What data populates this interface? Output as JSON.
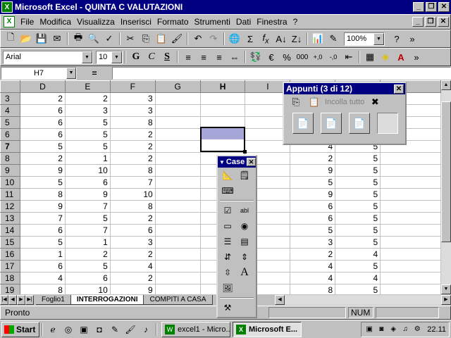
{
  "window": {
    "title": "Microsoft Excel - QUINTA C VALUTAZIONI"
  },
  "menu": [
    "File",
    "Modifica",
    "Visualizza",
    "Inserisci",
    "Formato",
    "Strumenti",
    "Dati",
    "Finestra",
    "?"
  ],
  "toolbar": {
    "zoom": "100%"
  },
  "format": {
    "font": "Arial",
    "size": "10"
  },
  "formula": {
    "cell": "H7",
    "fx": "=",
    "value": ""
  },
  "columns": [
    "D",
    "E",
    "F",
    "G",
    "H",
    "I",
    "J",
    "K"
  ],
  "selected": {
    "column": "H",
    "row": "7"
  },
  "rows": [
    {
      "n": "3",
      "cells": [
        "2",
        "2",
        "3",
        "",
        "",
        "",
        "",
        ""
      ]
    },
    {
      "n": "4",
      "cells": [
        "6",
        "3",
        "3",
        "",
        "",
        "",
        "",
        ""
      ]
    },
    {
      "n": "5",
      "cells": [
        "6",
        "5",
        "8",
        "",
        "",
        "",
        "",
        ""
      ]
    },
    {
      "n": "6",
      "cells": [
        "6",
        "5",
        "2",
        "",
        "",
        "",
        "",
        ""
      ]
    },
    {
      "n": "7",
      "cells": [
        "5",
        "5",
        "2",
        "",
        "",
        "",
        "4",
        "5"
      ]
    },
    {
      "n": "8",
      "cells": [
        "2",
        "1",
        "2",
        "",
        "",
        "",
        "2",
        "5"
      ]
    },
    {
      "n": "9",
      "cells": [
        "9",
        "10",
        "8",
        "",
        "",
        "",
        "9",
        "5"
      ]
    },
    {
      "n": "10",
      "cells": [
        "5",
        "6",
        "7",
        "",
        "",
        "",
        "5",
        "5"
      ]
    },
    {
      "n": "11",
      "cells": [
        "8",
        "9",
        "10",
        "",
        "",
        "",
        "9",
        "5"
      ]
    },
    {
      "n": "12",
      "cells": [
        "9",
        "7",
        "8",
        "",
        "",
        "",
        "6",
        "5"
      ]
    },
    {
      "n": "13",
      "cells": [
        "7",
        "5",
        "2",
        "",
        "",
        "",
        "6",
        "5"
      ]
    },
    {
      "n": "14",
      "cells": [
        "6",
        "7",
        "6",
        "",
        "",
        "",
        "5",
        "5"
      ]
    },
    {
      "n": "15",
      "cells": [
        "5",
        "1",
        "3",
        "",
        "",
        "",
        "3",
        "5"
      ]
    },
    {
      "n": "16",
      "cells": [
        "1",
        "2",
        "2",
        "",
        "",
        "",
        "2",
        "4"
      ]
    },
    {
      "n": "17",
      "cells": [
        "6",
        "5",
        "4",
        "",
        "",
        "",
        "4",
        "5"
      ]
    },
    {
      "n": "18",
      "cells": [
        "4",
        "6",
        "2",
        "",
        "",
        "",
        "4",
        "4"
      ]
    },
    {
      "n": "19",
      "cells": [
        "8",
        "10",
        "9",
        "",
        "",
        "",
        "8",
        "5"
      ]
    }
  ],
  "sheets": [
    "Foglio1",
    "INTERROGAZIONI",
    "COMPITI A CASA"
  ],
  "active_sheet": "INTERROGAZIONI",
  "status": {
    "text": "Pronto",
    "num": "NUM"
  },
  "clipboard": {
    "title": "Appunti (3 di 12)",
    "paste_all": "Incolla tutto"
  },
  "controls": {
    "title": "Case"
  },
  "taskbar": {
    "start": "Start",
    "task1": "excel1 - Micro...",
    "task2": "Microsoft E...",
    "clock": "22.11"
  },
  "colors": {
    "titlebar": "#000080",
    "selection": "#a6a6d8"
  }
}
